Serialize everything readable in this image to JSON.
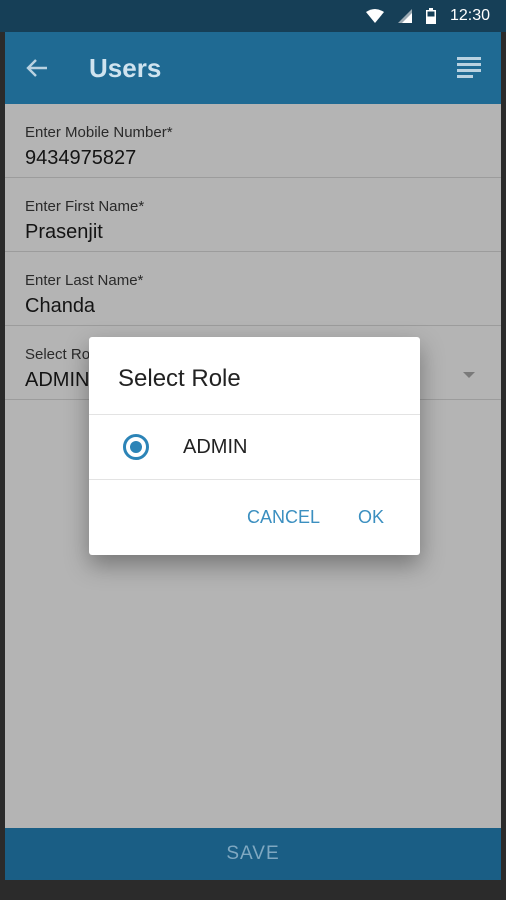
{
  "status_bar": {
    "time": "12:30",
    "icons": [
      "wifi-icon",
      "signal-icon",
      "battery-icon"
    ]
  },
  "app_bar": {
    "title": "Users",
    "back_icon": "arrow-left-icon",
    "menu_icon": "list-icon"
  },
  "form": {
    "fields": [
      {
        "label": "Enter Mobile Number*",
        "value": "9434975827"
      },
      {
        "label": "Enter First Name*",
        "value": "Prasenjit"
      },
      {
        "label": "Enter Last Name*",
        "value": "Chanda"
      },
      {
        "label": "Select Role",
        "value": "ADMIN"
      }
    ],
    "save_label": "SAVE"
  },
  "dialog": {
    "title": "Select Role",
    "options": [
      {
        "label": "ADMIN",
        "selected": true
      }
    ],
    "cancel_label": "CANCEL",
    "ok_label": "OK"
  },
  "colors": {
    "app_bar": "#1f6a93",
    "status_bar": "#163f57",
    "accent": "#2c84b7",
    "scrim_content": "#b4b4b4"
  }
}
